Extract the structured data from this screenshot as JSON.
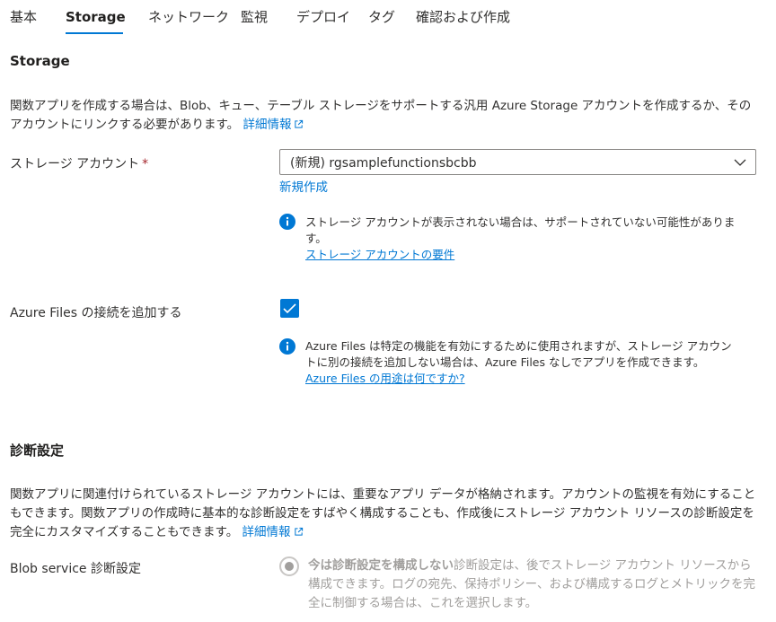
{
  "tabs": [
    {
      "label": "基本"
    },
    {
      "label": "Storage"
    },
    {
      "label": "ネットワーク"
    },
    {
      "label": "監視"
    },
    {
      "label": "デプロイ"
    },
    {
      "label": "タグ"
    },
    {
      "label": "確認および作成"
    }
  ],
  "active_tab": "Storage",
  "storage_section": {
    "title": "Storage",
    "description": "関数アプリを作成する場合は、Blob、キュー、テーブル ストレージをサポートする汎用 Azure Storage アカウントを作成するか、そのアカウントにリンクする必要があります。",
    "learn_more": "詳細情報"
  },
  "storage_account": {
    "label": "ストレージ アカウント",
    "required_mark": "*",
    "selected_value": "(新規) rgsamplefunctionsbcbb",
    "create_new_link": "新規作成",
    "info_text": "ストレージ アカウントが表示されない場合は、サポートされていない可能性があります。",
    "info_link": "ストレージ アカウントの要件"
  },
  "azure_files": {
    "label": "Azure Files の接続を追加する",
    "checked": true,
    "info_text": "Azure Files は特定の機能を有効にするために使用されますが、ストレージ アカウントに別の接続を追加しない場合は、Azure Files なしでアプリを作成できます。",
    "info_link": "Azure Files の用途は何ですか?"
  },
  "diagnostics_section": {
    "title": "診断設定",
    "description": "関数アプリに関連付けられているストレージ アカウントには、重要なアプリ データが格納されます。アカウントの監視を有効にすることもできます。関数アプリの作成時に基本的な診断設定をすばやく構成することも、作成後にストレージ アカウント リソースの診断設定を完全にカスタマイズすることもできます。",
    "learn_more": "詳細情報"
  },
  "blob_service": {
    "label": "Blob service 診断設定",
    "option_bold": "今は診断設定を構成しない",
    "option_text": "診断設定は、後でストレージ アカウント リソースから構成できます。ログの宛先、保持ポリシー、および構成するログとメトリックを完全に制御する場合は、これを選択します。"
  },
  "colors": {
    "accent": "#0078d4",
    "required": "#a4262c",
    "disabled_text": "#a19f9d"
  },
  "icons": {
    "external_link": "external-link-icon",
    "info": "info-icon",
    "chevron": "chevron-down-icon",
    "check": "checkmark-icon"
  }
}
